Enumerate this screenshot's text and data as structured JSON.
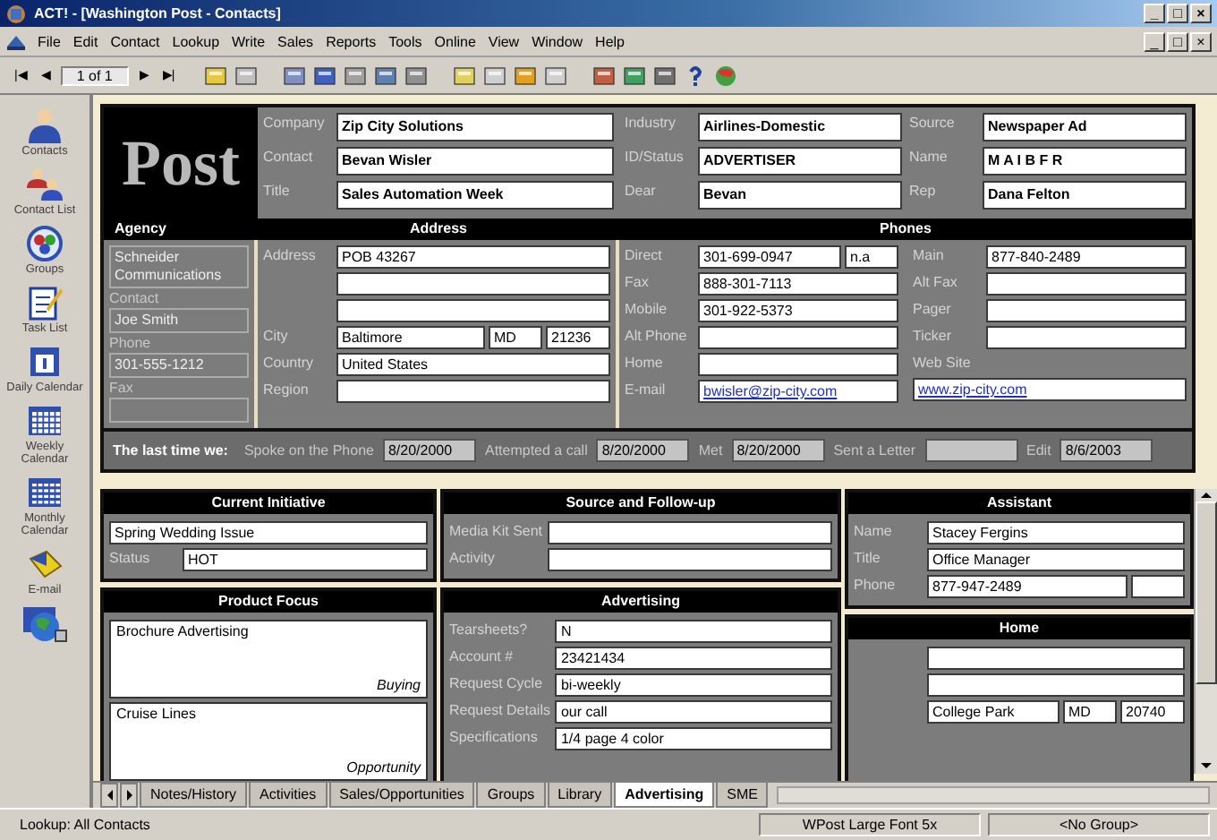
{
  "window": {
    "title": "ACT! - [Washington Post - Contacts]",
    "controls": [
      "_",
      "□",
      "×"
    ]
  },
  "menu": {
    "items": [
      "File",
      "Edit",
      "Contact",
      "Lookup",
      "Write",
      "Sales",
      "Reports",
      "Tools",
      "Online",
      "View",
      "Window",
      "Help"
    ],
    "doc_controls": [
      "_",
      "□",
      "×"
    ]
  },
  "toolbar": {
    "nav_back": [
      "|◀",
      "◀"
    ],
    "record": "1 of 1",
    "nav_forward": [
      "▶",
      "▶|"
    ]
  },
  "sidebar": [
    {
      "kind": "contacts",
      "label": "Contacts"
    },
    {
      "kind": "contact_list",
      "label": "Contact List"
    },
    {
      "kind": "groups",
      "label": "Groups"
    },
    {
      "kind": "task_list",
      "label": "Task List"
    },
    {
      "kind": "daily",
      "label": "Daily Calendar"
    },
    {
      "kind": "weekly",
      "label": "Weekly Calendar"
    },
    {
      "kind": "monthly",
      "label": "Monthly Calendar"
    },
    {
      "kind": "email",
      "label": "E-mail"
    },
    {
      "kind": "globe"
    }
  ],
  "header": {
    "logo": "Post",
    "groups": [
      [
        {
          "kind": "field",
          "label": "Company",
          "value": "Zip City Solutions"
        },
        {
          "kind": "field",
          "label": "Contact",
          "value": "Bevan Wisler"
        },
        {
          "kind": "field",
          "label": "Title",
          "value": "Sales Automation Week"
        }
      ],
      [
        {
          "kind": "field",
          "label": "Industry",
          "value": "Airlines-Domestic"
        },
        {
          "kind": "field",
          "label": "ID/Status",
          "value": "ADVERTISER"
        },
        {
          "kind": "field",
          "label": "Dear",
          "value": "Bevan"
        }
      ],
      [
        {
          "kind": "field",
          "label": "Source",
          "value": "Newspaper Ad"
        },
        {
          "kind": "field",
          "label": "Name",
          "value": "M A I B F R"
        },
        {
          "kind": "field",
          "label": "Rep",
          "value": "Dana Felton"
        }
      ]
    ]
  },
  "agency": {
    "title": "Agency",
    "name": "Schneider Communications",
    "fields": [
      {
        "label": "Contact",
        "value": "Joe Smith"
      },
      {
        "label": "Phone",
        "value": "301-555-1212"
      },
      {
        "label": "Fax"
      }
    ]
  },
  "address": {
    "title": "Address",
    "rows": [
      {
        "kind": "field",
        "label": "Address",
        "value": "POB 43267"
      },
      {
        "kind": "field"
      },
      {
        "kind": "field"
      },
      {
        "kind": "city",
        "label": "City",
        "value": "Baltimore",
        "state": "MD",
        "zip": "21236"
      },
      {
        "kind": "field",
        "label": "Country",
        "value": "United States"
      },
      {
        "kind": "field",
        "label": "Region"
      }
    ]
  },
  "phones": {
    "title": "Phones",
    "columns": [
      [
        {
          "kind": "ext",
          "label": "Direct",
          "value": "301-699-0947",
          "ext": "n.a"
        },
        {
          "kind": "field",
          "label": "Fax",
          "value": "888-301-7113"
        },
        {
          "kind": "field",
          "label": "Mobile",
          "value": "301-922-5373"
        },
        {
          "kind": "field",
          "label": "Alt Phone"
        },
        {
          "kind": "field",
          "label": "Home"
        },
        {
          "kind": "link",
          "label": "E-mail",
          "value": "bwisler@zip-city.com"
        }
      ],
      [
        {
          "kind": "field",
          "label": "Main",
          "value": "877-840-2489"
        },
        {
          "kind": "field",
          "label": "Alt Fax"
        },
        {
          "kind": "field",
          "label": "Pager"
        },
        {
          "kind": "field",
          "label": "Ticker"
        },
        {
          "kind": "link_above",
          "label": "Web Site",
          "value": "www.zip-city.com"
        }
      ]
    ]
  },
  "last_time": {
    "label": "The last time we:",
    "items": [
      {
        "label": "Spoke on the Phone",
        "value": "8/20/2000"
      },
      {
        "label": "Attempted a call",
        "value": "8/20/2000"
      },
      {
        "label": "Met",
        "value": "8/20/2000"
      },
      {
        "label": "Sent a Letter"
      },
      {
        "label": "Edit",
        "value": "8/6/2003"
      }
    ]
  },
  "bottom": [
    [
      {
        "title": "Current Initiative",
        "rows": [
          {
            "kind": "wide",
            "value": "Spring Wedding Issue"
          },
          {
            "kind": "field",
            "label": "Status",
            "value": "HOT"
          }
        ]
      },
      {
        "title": "Product Focus",
        "rows": [
          {
            "kind": "area",
            "value": "Brochure Advertising",
            "note": "Buying"
          },
          {
            "kind": "area",
            "value": "Cruise Lines",
            "note": "Opportunity"
          }
        ]
      }
    ],
    [
      {
        "title": "Source and Follow-up",
        "rows": [
          {
            "kind": "field",
            "label": "Media Kit Sent"
          },
          {
            "kind": "field",
            "label": "Activity"
          }
        ]
      },
      {
        "title": "Advertising",
        "rows": [
          {
            "kind": "field",
            "label": "Tearsheets?",
            "value": "N"
          },
          {
            "kind": "field",
            "label": "Account #",
            "value": "23421434"
          },
          {
            "kind": "field",
            "label": "Request Cycle",
            "value": "bi-weekly"
          },
          {
            "kind": "field",
            "label": "Request Details",
            "value": "our call"
          },
          {
            "kind": "field",
            "label": "Specifications",
            "value": "1/4 page 4 color"
          }
        ]
      }
    ],
    [
      {
        "title": "Assistant",
        "rows": [
          {
            "kind": "field",
            "label": "Name",
            "value": "Stacey Fergins"
          },
          {
            "kind": "field",
            "label": "Title",
            "value": "Office Manager"
          },
          {
            "kind": "ext",
            "label": "Phone",
            "value": "877-947-2489"
          }
        ]
      },
      {
        "title": "Home",
        "rows": [
          {
            "kind": "field"
          },
          {
            "kind": "field"
          },
          {
            "kind": "city",
            "value": "College Park",
            "state": "MD",
            "zip": "20740"
          }
        ]
      }
    ]
  ],
  "tabs": {
    "items": [
      {
        "label": "Notes/History",
        "selected": false
      },
      {
        "label": "Activities",
        "selected": false
      },
      {
        "label": "Sales/Opportunities",
        "selected": false
      },
      {
        "label": "Groups",
        "selected": false
      },
      {
        "label": "Library",
        "selected": false
      },
      {
        "label": "Advertising",
        "selected": true
      },
      {
        "label": "SME",
        "selected": false
      }
    ]
  },
  "status_bar": [
    "Lookup: All Contacts",
    "WPost Large Font 5x",
    "<No Group>"
  ]
}
